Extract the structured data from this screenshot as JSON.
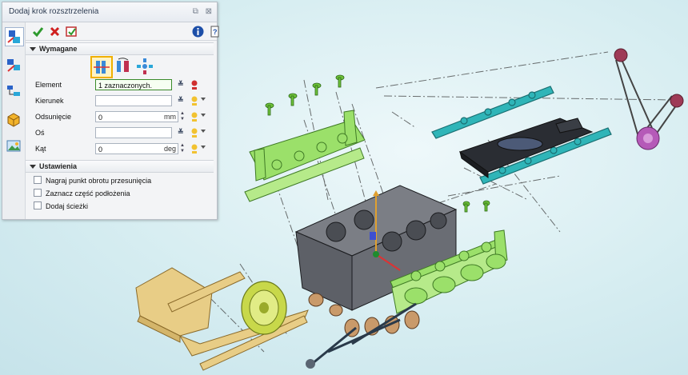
{
  "panel": {
    "title": "Dodaj krok rozsztrzelenia",
    "controls": {
      "pin": "⧉",
      "close": "⊠"
    },
    "sections": {
      "required": "Wymagane",
      "settings": "Ustawienia"
    },
    "fields": {
      "element": {
        "label": "Element",
        "value": "1 zaznaczonych."
      },
      "direction": {
        "label": "Kierunek",
        "value": ""
      },
      "offset": {
        "label": "Odsunięcie",
        "value": "0",
        "unit": "mm"
      },
      "axis": {
        "label": "Oś",
        "value": ""
      },
      "angle": {
        "label": "Kąt",
        "value": "0",
        "unit": "deg"
      }
    },
    "options": [
      "Nagraj punkt obrotu przesunięcia",
      "Zaznacz część podłożenia",
      "Dodaj ścieżki"
    ],
    "icons": {
      "ok": "check-icon",
      "cancel": "x-icon",
      "apply": "apply-icon",
      "info": "info-icon",
      "help": "help-icon"
    },
    "colors": {
      "ok": "#2e9a2e",
      "cancel": "#d02020",
      "selected_mode": "#f0b000"
    }
  }
}
